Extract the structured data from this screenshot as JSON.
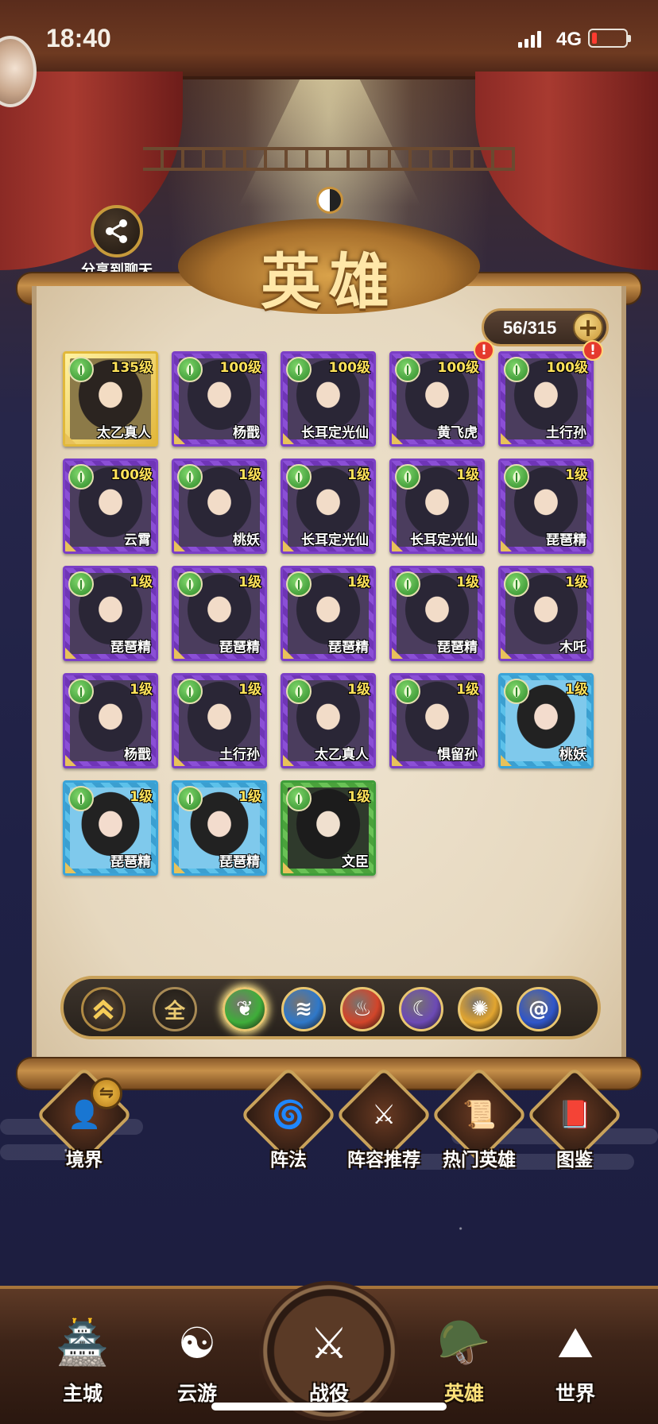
{
  "status_bar": {
    "time": "18:40",
    "network": "4G"
  },
  "share": {
    "label": "分享到聊天"
  },
  "title": "英雄",
  "hero_count": "56/315",
  "heroes": [
    {
      "name": "太乙真人",
      "level": "135级",
      "frame": "gold",
      "alert": false
    },
    {
      "name": "杨戬",
      "level": "100级",
      "frame": "purple",
      "alert": false
    },
    {
      "name": "长耳定光仙",
      "level": "100级",
      "frame": "purple",
      "alert": false
    },
    {
      "name": "黄飞虎",
      "level": "100级",
      "frame": "purple",
      "alert": true
    },
    {
      "name": "土行孙",
      "level": "100级",
      "frame": "purple",
      "alert": true
    },
    {
      "name": "云霄",
      "level": "100级",
      "frame": "purple",
      "alert": false
    },
    {
      "name": "桃妖",
      "level": "1级",
      "frame": "purple",
      "alert": false
    },
    {
      "name": "长耳定光仙",
      "level": "1级",
      "frame": "purple",
      "alert": false
    },
    {
      "name": "长耳定光仙",
      "level": "1级",
      "frame": "purple",
      "alert": false
    },
    {
      "name": "琵琶精",
      "level": "1级",
      "frame": "purple",
      "alert": false
    },
    {
      "name": "琵琶精",
      "level": "1级",
      "frame": "purple",
      "alert": false
    },
    {
      "name": "琵琶精",
      "level": "1级",
      "frame": "purple",
      "alert": false
    },
    {
      "name": "琵琶精",
      "level": "1级",
      "frame": "purple",
      "alert": false
    },
    {
      "name": "琵琶精",
      "level": "1级",
      "frame": "purple",
      "alert": false
    },
    {
      "name": "木吒",
      "level": "1级",
      "frame": "purple",
      "alert": false
    },
    {
      "name": "杨戬",
      "level": "1级",
      "frame": "purple",
      "alert": false
    },
    {
      "name": "土行孙",
      "level": "1级",
      "frame": "purple",
      "alert": false
    },
    {
      "name": "太乙真人",
      "level": "1级",
      "frame": "purple",
      "alert": false
    },
    {
      "name": "惧留孙",
      "level": "1级",
      "frame": "purple",
      "alert": false
    },
    {
      "name": "桃妖",
      "level": "1级",
      "frame": "blue",
      "alert": false
    },
    {
      "name": "琵琶精",
      "level": "1级",
      "frame": "blue",
      "alert": false
    },
    {
      "name": "琵琶精",
      "level": "1级",
      "frame": "blue",
      "alert": false
    },
    {
      "name": "文臣",
      "level": "1级",
      "frame": "green",
      "alert": false
    }
  ],
  "alert_mark": "!",
  "filters": {
    "rank_icon": "chevron-up-double-icon",
    "all_label": "全",
    "elements": [
      {
        "name": "wood",
        "icon": "leaf-icon",
        "color": "#3fae3a"
      },
      {
        "name": "water",
        "icon": "water-icon",
        "color": "#2f78c9"
      },
      {
        "name": "fire",
        "icon": "fire-icon",
        "color": "#d2452a"
      },
      {
        "name": "dark",
        "icon": "moon-icon",
        "color": "#6c4ab5"
      },
      {
        "name": "light",
        "icon": "sun-icon",
        "color": "#e2a52f"
      },
      {
        "name": "wind",
        "icon": "swirl-icon",
        "color": "#2f56c9"
      }
    ]
  },
  "features": {
    "realm": "境界",
    "formation": "阵法",
    "lineup": "阵容推荐",
    "popular": "热门英雄",
    "codex": "图鉴",
    "swap_glyph": "⇋"
  },
  "nav": {
    "items": [
      {
        "label": "主城",
        "icon": "palace-icon"
      },
      {
        "label": "云游",
        "icon": "taiji-cloud-icon"
      },
      {
        "label": "战役",
        "icon": "crossed-swords-icon"
      },
      {
        "label": "英雄",
        "icon": "hero-helmet-icon",
        "active": true
      },
      {
        "label": "世界",
        "icon": "mountain-icon"
      }
    ]
  }
}
